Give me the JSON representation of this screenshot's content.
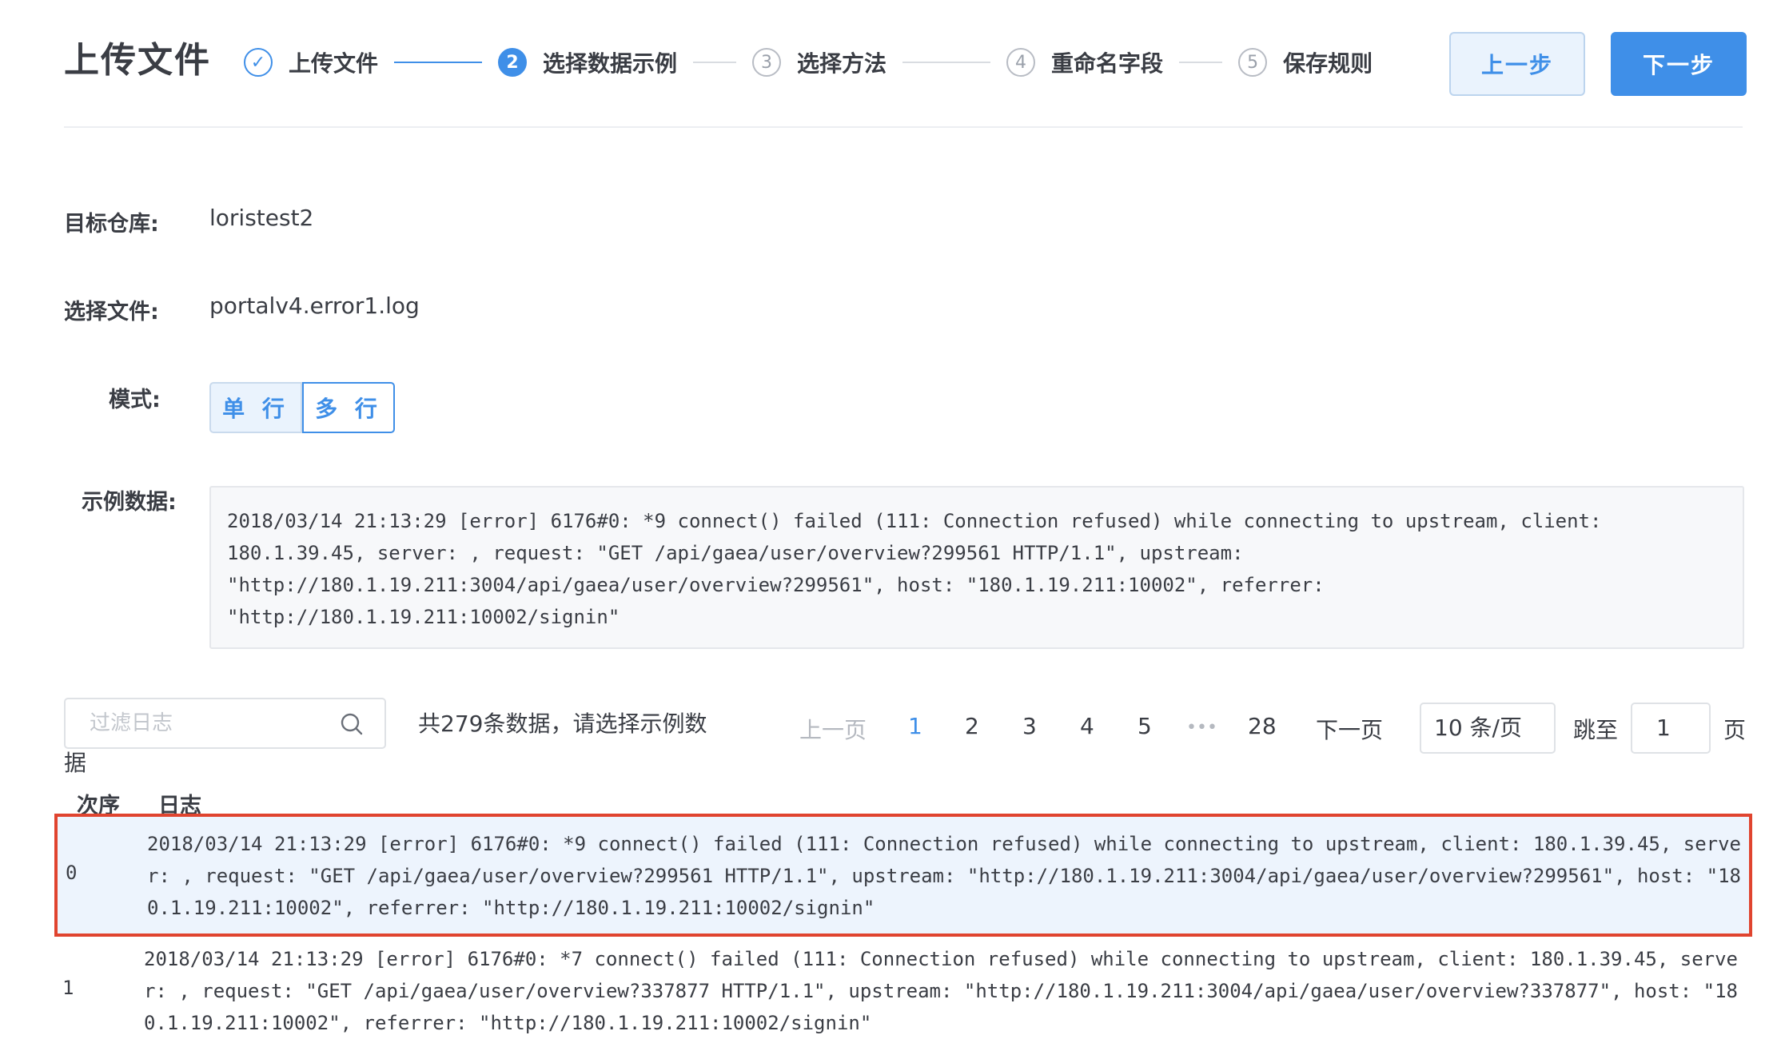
{
  "header": {
    "title": "上传文件",
    "steps": [
      {
        "num": "✓",
        "label": "上传文件",
        "state": "done"
      },
      {
        "num": "2",
        "label": "选择数据示例",
        "state": "active"
      },
      {
        "num": "3",
        "label": "选择方法",
        "state": "todo"
      },
      {
        "num": "4",
        "label": "重命名字段",
        "state": "todo"
      },
      {
        "num": "5",
        "label": "保存规则",
        "state": "todo"
      }
    ],
    "prev_label": "上一步",
    "next_label": "下一步"
  },
  "form": {
    "repo_label": "目标仓库:",
    "repo_value": "loristest2",
    "file_label": "选择文件:",
    "file_value": "portalv4.error1.log",
    "mode_label": "模式:",
    "mode_single": "单 行",
    "mode_multi": "多 行",
    "sample_label": "示例数据:",
    "sample_text": "2018/03/14 21:13:29 [error] 6176#0: *9 connect() failed (111: Connection refused) while connecting to upstream, client:\n180.1.39.45, server: , request: \"GET /api/gaea/user/overview?299561 HTTP/1.1\", upstream:\n\"http://180.1.19.211:3004/api/gaea/user/overview?299561\", host: \"180.1.19.211:10002\", referrer:\n\"http://180.1.19.211:10002/signin\""
  },
  "filter": {
    "placeholder": "过滤日志",
    "total_part1": "共279条数据，请选择示例数",
    "total_part2": "据"
  },
  "pagination": {
    "prev": "上一页",
    "pages": [
      "1",
      "2",
      "3",
      "4",
      "5"
    ],
    "ellipsis": "•••",
    "last": "28",
    "next": "下一页",
    "page_size": "10 条/页",
    "jump_label": "跳至",
    "jump_value": "1",
    "jump_unit": "页"
  },
  "table": {
    "col_index": "次序",
    "col_log": "日志",
    "rows": [
      {
        "index": "0",
        "log": "2018/03/14 21:13:29 [error] 6176#0: *9 connect() failed (111: Connection refused) while connecting to upstream, client: 180.1.39.45, serve\nr: , request: \"GET /api/gaea/user/overview?299561 HTTP/1.1\", upstream: \"http://180.1.19.211:3004/api/gaea/user/overview?299561\", host: \"18\n0.1.19.211:10002\", referrer: \"http://180.1.19.211:10002/signin\""
      },
      {
        "index": "1",
        "log": "2018/03/14 21:13:29 [error] 6176#0: *7 connect() failed (111: Connection refused) while connecting to upstream, client: 180.1.39.45, serve\nr: , request: \"GET /api/gaea/user/overview?337877 HTTP/1.1\", upstream: \"http://180.1.19.211:3004/api/gaea/user/overview?337877\", host: \"18\n0.1.19.211:10002\", referrer: \"http://180.1.19.211:10002/signin\""
      }
    ]
  },
  "colors": {
    "primary": "#3f8fe8",
    "selected_border": "#e0442f",
    "selected_bg": "#edf4fd"
  }
}
